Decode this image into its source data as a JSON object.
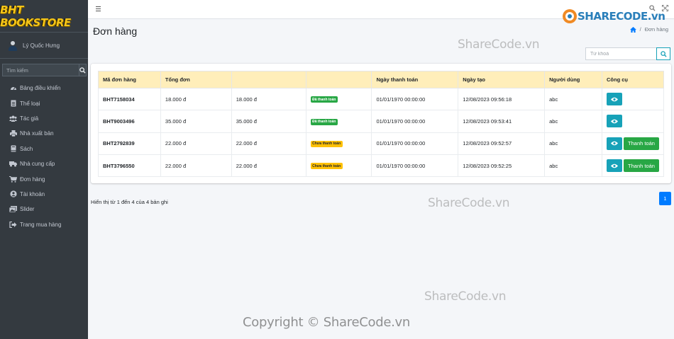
{
  "brand": {
    "name": "BHT BOOKSTORE"
  },
  "user": {
    "name": "Lý Quốc Hưng"
  },
  "sidebar": {
    "search_placeholder": "Tìm kiếm",
    "items": [
      {
        "label": "Bảng điều khiển",
        "icon": "dashboard-icon"
      },
      {
        "label": "Thể loại",
        "icon": "file-icon"
      },
      {
        "label": "Tác giả",
        "icon": "users-icon"
      },
      {
        "label": "Nhà xuất bản",
        "icon": "printer-icon"
      },
      {
        "label": "Sách",
        "icon": "book-icon"
      },
      {
        "label": "Nhà cung cấp",
        "icon": "truck-icon"
      },
      {
        "label": "Đơn hàng",
        "icon": "cart-icon"
      },
      {
        "label": "Tài khoản",
        "icon": "user-circle-icon"
      },
      {
        "label": "Slider",
        "icon": "images-icon"
      },
      {
        "label": "Trang mua hàng",
        "icon": "sign-out-icon"
      }
    ]
  },
  "header": {
    "title": "Đơn hàng",
    "breadcrumb_current": "Đơn hàng"
  },
  "search": {
    "placeholder": "Từ khoá"
  },
  "table": {
    "columns": [
      "Mã đơn hàng",
      "Tổng đơn",
      "",
      "",
      "Ngày thanh toán",
      "Ngày tạo",
      "Người dùng",
      "Công cụ"
    ],
    "rows": [
      {
        "code": "BHT7158034",
        "total": "18.000 đ",
        "paid": "18.000 đ",
        "status": "Đã thanh toán",
        "status_type": "paid",
        "pay_date": "01/01/1970 00:00:00",
        "created": "12/08/2023 09:56:18",
        "user": "abc",
        "show_pay": false
      },
      {
        "code": "BHT9003496",
        "total": "35.000 đ",
        "paid": "35.000 đ",
        "status": "Đã thanh toán",
        "status_type": "paid",
        "pay_date": "01/01/1970 00:00:00",
        "created": "12/08/2023 09:53:41",
        "user": "abc",
        "show_pay": false
      },
      {
        "code": "BHT2792839",
        "total": "22.000 đ",
        "paid": "22.000 đ",
        "status": "Chưa thanh toán",
        "status_type": "unpaid",
        "pay_date": "01/01/1970 00:00:00",
        "created": "12/08/2023 09:52:57",
        "user": "abc",
        "show_pay": true
      },
      {
        "code": "BHT3796550",
        "total": "22.000 đ",
        "paid": "22.000 đ",
        "status": "Chưa thanh toán",
        "status_type": "unpaid",
        "pay_date": "01/01/1970 00:00:00",
        "created": "12/08/2023 09:52:25",
        "user": "abc",
        "show_pay": true
      }
    ],
    "pay_button_label": "Thanh toán"
  },
  "footer": {
    "info": "Hiển thị từ 1 đến 4 của 4 bản ghi",
    "page": "1"
  },
  "watermarks": {
    "logo": "SHARECODE.vn",
    "text1": "ShareCode.vn",
    "text2": "ShareCode.vn",
    "text3": "ShareCode.vn",
    "copyright": "Copyright © ShareCode.vn"
  },
  "colors": {
    "sidebar": "#343a40",
    "header_row": "#ffeeba",
    "info": "#17a2b8",
    "success": "#28a745",
    "warning": "#ffc107",
    "primary": "#007bff"
  }
}
